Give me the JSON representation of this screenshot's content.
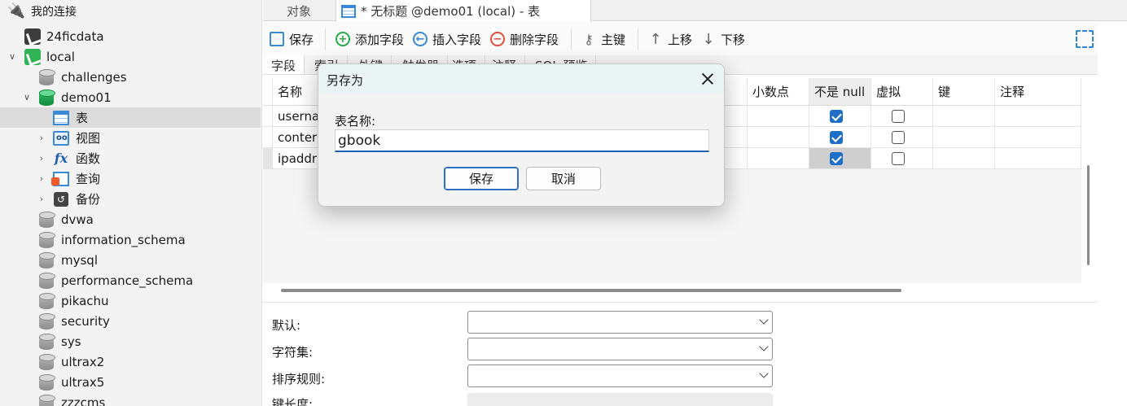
{
  "sidebar": {
    "header": "我的连接",
    "items": [
      {
        "label": "24ficdata"
      },
      {
        "label": "local"
      },
      {
        "label": "challenges"
      },
      {
        "label": "demo01"
      },
      {
        "label": "表"
      },
      {
        "label": "视图"
      },
      {
        "label": "函数"
      },
      {
        "label": "查询"
      },
      {
        "label": "备份"
      },
      {
        "label": "dvwa"
      },
      {
        "label": "information_schema"
      },
      {
        "label": "mysql"
      },
      {
        "label": "performance_schema"
      },
      {
        "label": "pikachu"
      },
      {
        "label": "security"
      },
      {
        "label": "sys"
      },
      {
        "label": "ultrax2"
      },
      {
        "label": "ultrax5"
      },
      {
        "label": "zzzcms"
      }
    ]
  },
  "tabs": {
    "objects": "对象",
    "active": "* 无标题 @demo01 (local) - 表"
  },
  "toolbar": {
    "save": "保存",
    "add_field": "添加字段",
    "insert_field": "插入字段",
    "delete_field": "删除字段",
    "primary_key": "主键",
    "move_up": "上移",
    "move_down": "下移"
  },
  "subtabs": [
    "字段",
    "索引",
    "外键",
    "触发器",
    "选项",
    "注释",
    "SQL 预览"
  ],
  "grid": {
    "headers": {
      "name": "名称",
      "decimals": "小数点",
      "not_null": "不是 null",
      "virtual": "虚拟",
      "key": "键",
      "comment": "注释"
    },
    "rows": [
      {
        "name": "userna",
        "not_null": true,
        "virtual": false
      },
      {
        "name": "conter",
        "not_null": true,
        "virtual": false
      },
      {
        "name": "ipaddr",
        "not_null": true,
        "virtual": false
      }
    ]
  },
  "properties": {
    "default_label": "默认:",
    "charset_label": "字符集:",
    "collation_label": "排序规则:",
    "key_length_label": "键长度:"
  },
  "dialog": {
    "title": "另存为",
    "field_label": "表名称:",
    "table_name": "gbook",
    "save_button": "保存",
    "cancel_button": "取消"
  }
}
